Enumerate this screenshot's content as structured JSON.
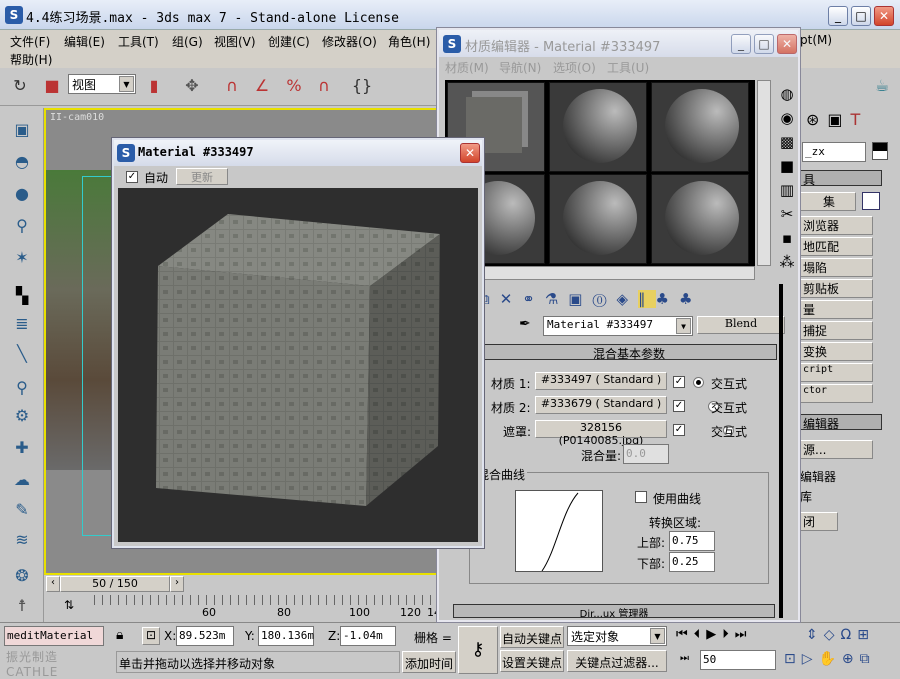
{
  "app": {
    "title": "4.4练习场景.max - 3ds max 7  - Stand-alone License",
    "icon": "3dsmax-logo-icon"
  },
  "menu": [
    "文件(F)",
    "编辑(E)",
    "工具(T)",
    "组(G)",
    "视图(V)",
    "创建(C)",
    "修改器(O)",
    "角色(H)",
    "pt(M)",
    "帮助(H)"
  ],
  "toolbar": {
    "view_combo": "视图"
  },
  "viewport": {
    "label": "II-cam010",
    "frame": "50 / 150"
  },
  "trackbar": {
    "ticks": [
      "60",
      "80",
      "100",
      "120",
      "14"
    ]
  },
  "status": {
    "script_field": "meditMaterial",
    "x_label": "X:",
    "x": "89.523m",
    "y_label": "Y:",
    "y": "180.136m",
    "z_label": "Z:",
    "z": "-1.04m",
    "grid_label": "栅格 =",
    "prompt": "单击并拖动以选择并移动对象",
    "add_time": "添加时间",
    "auto_key": "自动关键点",
    "set_key": "设置关键点",
    "selection_combo": "选定对象",
    "key_filter": "关键点过滤器...",
    "frame": "50",
    "watermark": "振光制造 CATHLE"
  },
  "medit": {
    "title": "材质编辑器 - Material #333497",
    "menu": [
      "材质(M)",
      "导航(N)",
      "选项(O)",
      "工具(U)"
    ],
    "material_name": "Material #333497",
    "type_button": "Blend",
    "rollout_title": "混合基本参数",
    "rows": [
      {
        "label": "材质 1:",
        "value": "#333497  ( Standard )",
        "checked": true,
        "interactive": "交互式",
        "selected": true
      },
      {
        "label": "材质 2:",
        "value": "#333679  ( Standard )",
        "checked": true,
        "interactive": "交互式",
        "selected": false
      },
      {
        "label": "遮罩:",
        "value": "328156 (P0140085.jpg)",
        "checked": true,
        "interactive": "交互式",
        "selected": false
      }
    ],
    "mix_amount_label": "混合量:",
    "mix_amount": "0.0",
    "curve_group": "混合曲线",
    "use_curve": "使用曲线",
    "use_curve_checked": false,
    "transition_label": "转换区域:",
    "upper_label": "上部:",
    "upper": "0.75",
    "lower_label": "下部:",
    "lower": "0.25",
    "next_rollout": "Dir...ux 管理器"
  },
  "float": {
    "title": "Material #333497",
    "auto_label": "自动",
    "auto_checked": true,
    "update_button": "更新"
  },
  "cmdpanel": {
    "name_field": "_zx",
    "section1": "具",
    "set_button": "集",
    "buttons": [
      "浏览器",
      "地匹配",
      "塌陷",
      "剪贴板",
      "量",
      "捕捉",
      "变换",
      "cript",
      "ctor"
    ],
    "section2": "编辑器",
    "source_button": "源...",
    "items": [
      "编辑器",
      "库"
    ],
    "close_button": "闭"
  }
}
